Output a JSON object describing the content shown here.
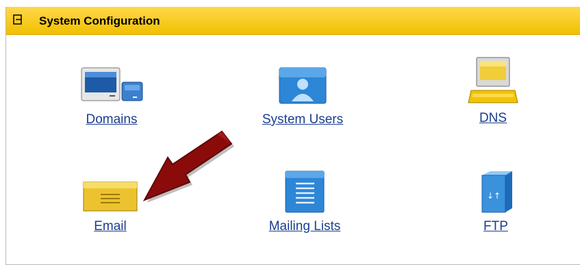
{
  "section": {
    "title": "System Configuration"
  },
  "items": [
    {
      "label": "Domains",
      "icon": "domains-icon"
    },
    {
      "label": "System Users",
      "icon": "system-users-icon"
    },
    {
      "label": "DNS",
      "icon": "dns-icon"
    },
    {
      "label": "Email",
      "icon": "email-icon"
    },
    {
      "label": "Mailing Lists",
      "icon": "mailing-lists-icon"
    },
    {
      "label": "FTP",
      "icon": "ftp-icon"
    }
  ],
  "colors": {
    "header": "#f1c000",
    "link": "#1a3d8f",
    "annotation_arrow": "#8b0b0b"
  }
}
